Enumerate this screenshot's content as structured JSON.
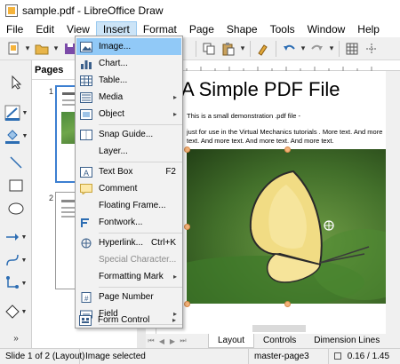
{
  "window": {
    "title": "sample.pdf - LibreOffice Draw"
  },
  "menubar": [
    "File",
    "Edit",
    "View",
    "Insert",
    "Format",
    "Page",
    "Shape",
    "Tools",
    "Window",
    "Help"
  ],
  "pages_panel": {
    "header": "Pages",
    "thumbs": [
      "1",
      "2"
    ]
  },
  "document": {
    "title": "A Simple PDF File",
    "line1": "This  is  a small demonstration .pdf file -",
    "line2": "just for use in the Virtual Mechanics tutorials . More text. And more",
    "line3": "text. And more text. And more text. And more text."
  },
  "insert_menu": {
    "items": [
      {
        "label": "Image...",
        "icon": "image-icon",
        "shortcut": "",
        "submenu": false,
        "disabled": false,
        "highlight": true
      },
      {
        "label": "Chart...",
        "icon": "chart-icon",
        "shortcut": "",
        "submenu": false,
        "disabled": false
      },
      {
        "label": "Table...",
        "icon": "table-icon",
        "shortcut": "",
        "submenu": false,
        "disabled": false
      },
      {
        "label": "Media",
        "icon": "media-icon",
        "shortcut": "",
        "submenu": true,
        "disabled": false
      },
      {
        "label": "Object",
        "icon": "object-icon",
        "shortcut": "",
        "submenu": true,
        "disabled": false
      },
      {
        "label": "Snap Guide...",
        "icon": "snap-guide-icon",
        "shortcut": "",
        "submenu": false,
        "disabled": false
      },
      {
        "label": "Layer...",
        "icon": "",
        "shortcut": "",
        "submenu": false,
        "disabled": false
      },
      {
        "label": "Text Box",
        "icon": "text-box-icon",
        "shortcut": "F2",
        "submenu": false,
        "disabled": false
      },
      {
        "label": "Comment",
        "icon": "comment-icon",
        "shortcut": "",
        "submenu": false,
        "disabled": false
      },
      {
        "label": "Floating Frame...",
        "icon": "",
        "shortcut": "",
        "submenu": false,
        "disabled": false
      },
      {
        "label": "Fontwork...",
        "icon": "fontwork-icon",
        "shortcut": "",
        "submenu": false,
        "disabled": false
      },
      {
        "label": "Hyperlink...",
        "icon": "hyperlink-icon",
        "shortcut": "Ctrl+K",
        "submenu": false,
        "disabled": false
      },
      {
        "label": "Special Character...",
        "icon": "",
        "shortcut": "",
        "submenu": false,
        "disabled": true
      },
      {
        "label": "Formatting Mark",
        "icon": "",
        "shortcut": "",
        "submenu": true,
        "disabled": false
      },
      {
        "label": "Page Number",
        "icon": "page-number-icon",
        "shortcut": "",
        "submenu": false,
        "disabled": false
      },
      {
        "label": "Field",
        "icon": "field-icon",
        "shortcut": "",
        "submenu": true,
        "disabled": false
      },
      {
        "label": "Form Control",
        "icon": "form-control-icon",
        "shortcut": "",
        "submenu": true,
        "disabled": false
      }
    ]
  },
  "tabs": [
    "Layout",
    "Controls",
    "Dimension Lines"
  ],
  "statusbar": {
    "slide": "Slide 1 of 2 (Layout)",
    "selection": "Image selected",
    "master": "master-page3",
    "coords": "0.16 / 1.45"
  },
  "colors": {
    "menu_highlight": "#91c9f7",
    "selection_border": "#3c7fd1",
    "handle": "#f2b37a"
  }
}
